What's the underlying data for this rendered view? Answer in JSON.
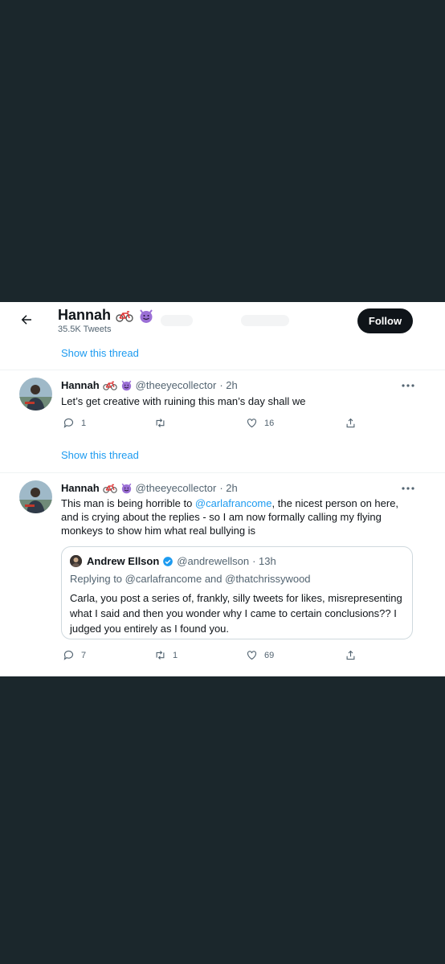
{
  "header": {
    "name": "Hannah",
    "tweet_count": "35.5K Tweets",
    "follow_label": "Follow"
  },
  "thread_link_1": "Show this thread",
  "tweet1": {
    "name": "Hannah",
    "handle": "@theeyecollector",
    "time": "· 2h",
    "text": "Let’s get creative with ruining this man’s day shall we",
    "replies": "1",
    "retweets": "",
    "likes": "16"
  },
  "thread_link_2": "Show this thread",
  "tweet2": {
    "name": "Hannah",
    "handle": "@theeyecollector",
    "time": "· 2h",
    "text_before": "This man is being horrible to ",
    "mention": "@carlafrancome",
    "text_after": ", the nicest person on here, and is crying about the replies - so I am now formally calling my flying monkeys to show him what real bullying is",
    "quote": {
      "name": "Andrew Ellson",
      "handle": "@andrewellson",
      "time": "· 13h",
      "replying_to": "Replying to @carlafrancome and @thatchrissywood",
      "text": "Carla, you post a series of, frankly, silly tweets for likes, misrepresenting what I said and then you wonder why I came to certain conclusions?? I judged you entirely as I found you."
    },
    "replies": "7",
    "retweets": "1",
    "likes": "69"
  },
  "icons": {
    "back": "arrow-left-icon",
    "bicycle": "bicycle-emoji-icon",
    "devil": "smiling-devil-emoji-icon",
    "more": "more-dots-icon",
    "reply": "reply-bubble-icon",
    "retweet": "retweet-icon",
    "like": "heart-icon",
    "share": "share-icon",
    "verified": "verified-badge-icon"
  },
  "colors": {
    "page_background": "#1b272c",
    "accent": "#1d9bf0",
    "text": "#0f1419",
    "secondary": "#536471",
    "devil": "#9b6fd6"
  }
}
